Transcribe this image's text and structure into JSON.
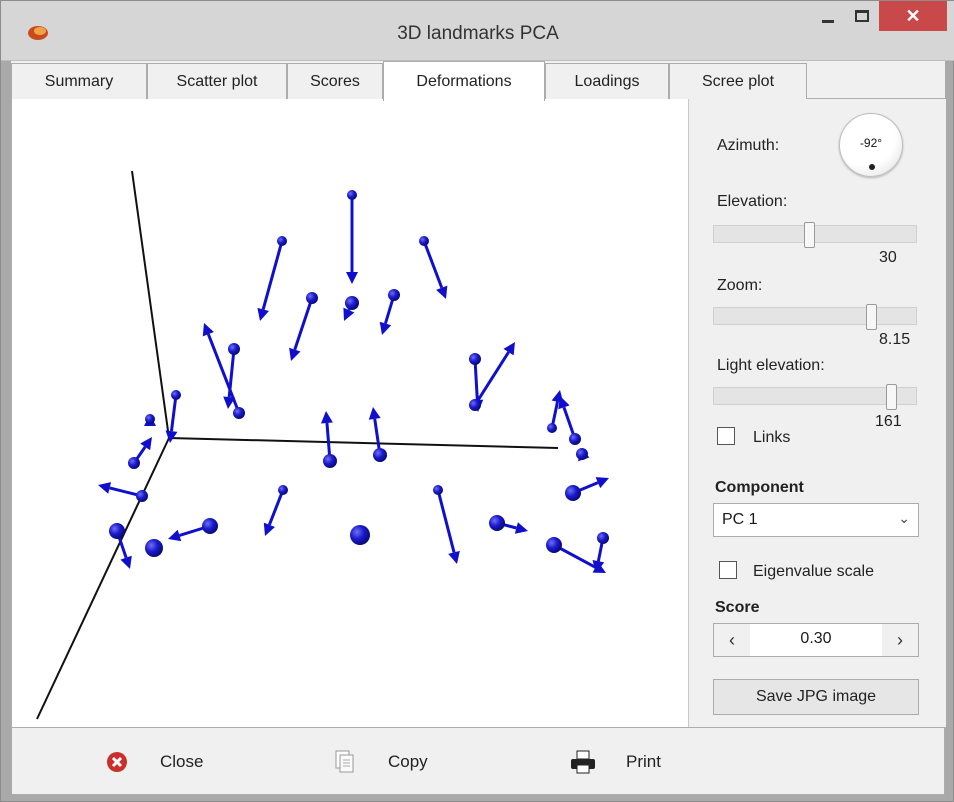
{
  "window": {
    "title": "3D landmarks PCA"
  },
  "tabs": [
    {
      "label": "Summary"
    },
    {
      "label": "Scatter plot"
    },
    {
      "label": "Scores"
    },
    {
      "label": "Deformations",
      "active": true
    },
    {
      "label": "Loadings"
    },
    {
      "label": "Scree plot"
    }
  ],
  "panel": {
    "azimuth_label": "Azimuth:",
    "azimuth_value": "-92°",
    "elevation_label": "Elevation:",
    "elevation_value": "30",
    "zoom_label": "Zoom:",
    "zoom_value": "8.15",
    "light_label": "Light elevation:",
    "light_value": "161",
    "links_label": "Links",
    "links_checked": false,
    "component_label": "Component",
    "component_selected": "PC 1",
    "eigen_label": "Eigenvalue scale",
    "eigen_checked": false,
    "score_label": "Score",
    "score_value": "0.30",
    "save_label": "Save JPG image"
  },
  "bottom": {
    "close_label": "Close",
    "copy_label": "Copy",
    "print_label": "Print"
  },
  "colors": {
    "landmark": "#1010cc",
    "close_button": "#c9484a",
    "axis": "#111111"
  }
}
